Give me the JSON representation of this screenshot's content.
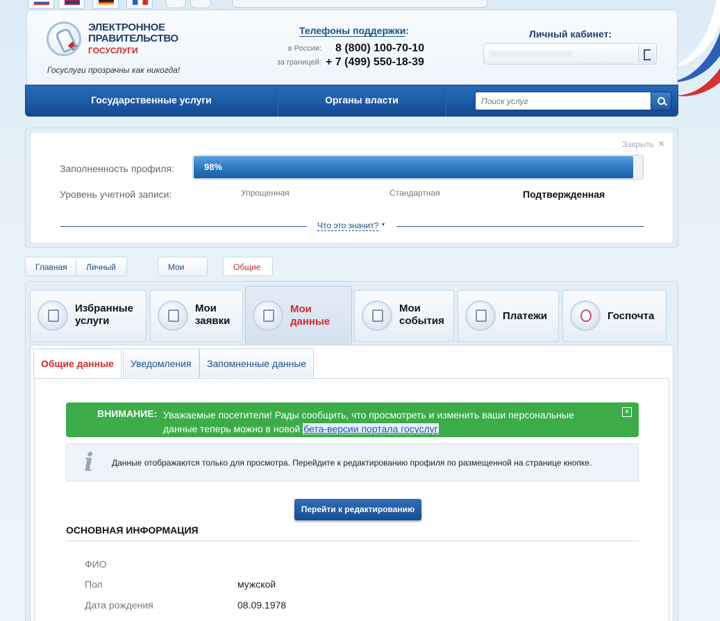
{
  "colors": {
    "nav": "#1c5aa6",
    "accent_red": "#d5282c",
    "alert_green": "#3cac48",
    "link": "#1a4f8a"
  },
  "header": {
    "logo": {
      "line1": "ЭЛЕКТРОННОЕ",
      "line2": "ПРАВИТЕЛЬСТВО",
      "sub": "ГОСУСЛУГИ"
    },
    "slogan": "Госуслуги прозрачны как никогда!",
    "support": {
      "title": "Телефоны поддержки",
      "colon": ":",
      "russia_label": "в России:",
      "russia_phone": "8 (800) 100-70-10",
      "abroad_label": "за границей:",
      "abroad_phone": "+ 7 (499) 550-18-39"
    },
    "cabinet": {
      "title": "Личный кабинет:",
      "exit_icon": "exit-icon"
    }
  },
  "nav": {
    "items": [
      "Государственные услуги",
      "Органы власти"
    ],
    "search_placeholder": "Поиск услуг",
    "search_icon": "search-icon"
  },
  "profile": {
    "close_label": "Закрыть",
    "close_icon": "×",
    "fill_label": "Заполненность профиля:",
    "fill_percent": 98,
    "fill_text": "98%",
    "level_label": "Уровень учетной записи:",
    "levels": [
      "Упрощенная",
      "Стандартная",
      "Подтвержденная"
    ],
    "active_level": "Подтвержденная",
    "what_link": "Что это значит?",
    "what_arrow": "▾"
  },
  "breadcrumb": [
    "Главная",
    "Личный кабинет",
    "Мои данные",
    "Общие данные"
  ],
  "tiles": [
    {
      "line1": "Избранные",
      "line2": "услуги",
      "icon": "favorites-icon"
    },
    {
      "line1": "Мои",
      "line2": "заявки",
      "icon": "checklist-icon"
    },
    {
      "line1": "Мои",
      "line2": "данные",
      "icon": "folder-icon"
    },
    {
      "line1": "Мои",
      "line2": "события",
      "icon": "calendar-icon"
    },
    {
      "line1": "Платежи",
      "line2": "",
      "icon": "payment-card-icon"
    },
    {
      "line1": "Госпочта",
      "line2": "",
      "icon": "at-mail-icon"
    }
  ],
  "active_tile": "Мои данные",
  "tabs": [
    "Общие данные",
    "Уведомления",
    "Запомненные данные"
  ],
  "active_tab": "Общие данные",
  "alert": {
    "title": "ВНИМАНИЕ:",
    "text": "Уважаемые посетители! Рады сообщить, что просмотреть и изменить ваши персональные данные теперь можно в новой",
    "link": "бета-версии портала госуслуг",
    "close": "×"
  },
  "info": {
    "icon": "i",
    "text": "Данные отображаются только для просмотра. Перейдите к редактированию профиля по размещенной на странице кнопке."
  },
  "edit_button": "Перейти к редактированию",
  "section_title": "ОСНОВНАЯ ИНФОРМАЦИЯ",
  "fields": [
    {
      "label": "ФИО",
      "value": ""
    },
    {
      "label": "Пол",
      "value": "мужской"
    },
    {
      "label": "Дата рождения",
      "value": "08.09.1978"
    }
  ]
}
